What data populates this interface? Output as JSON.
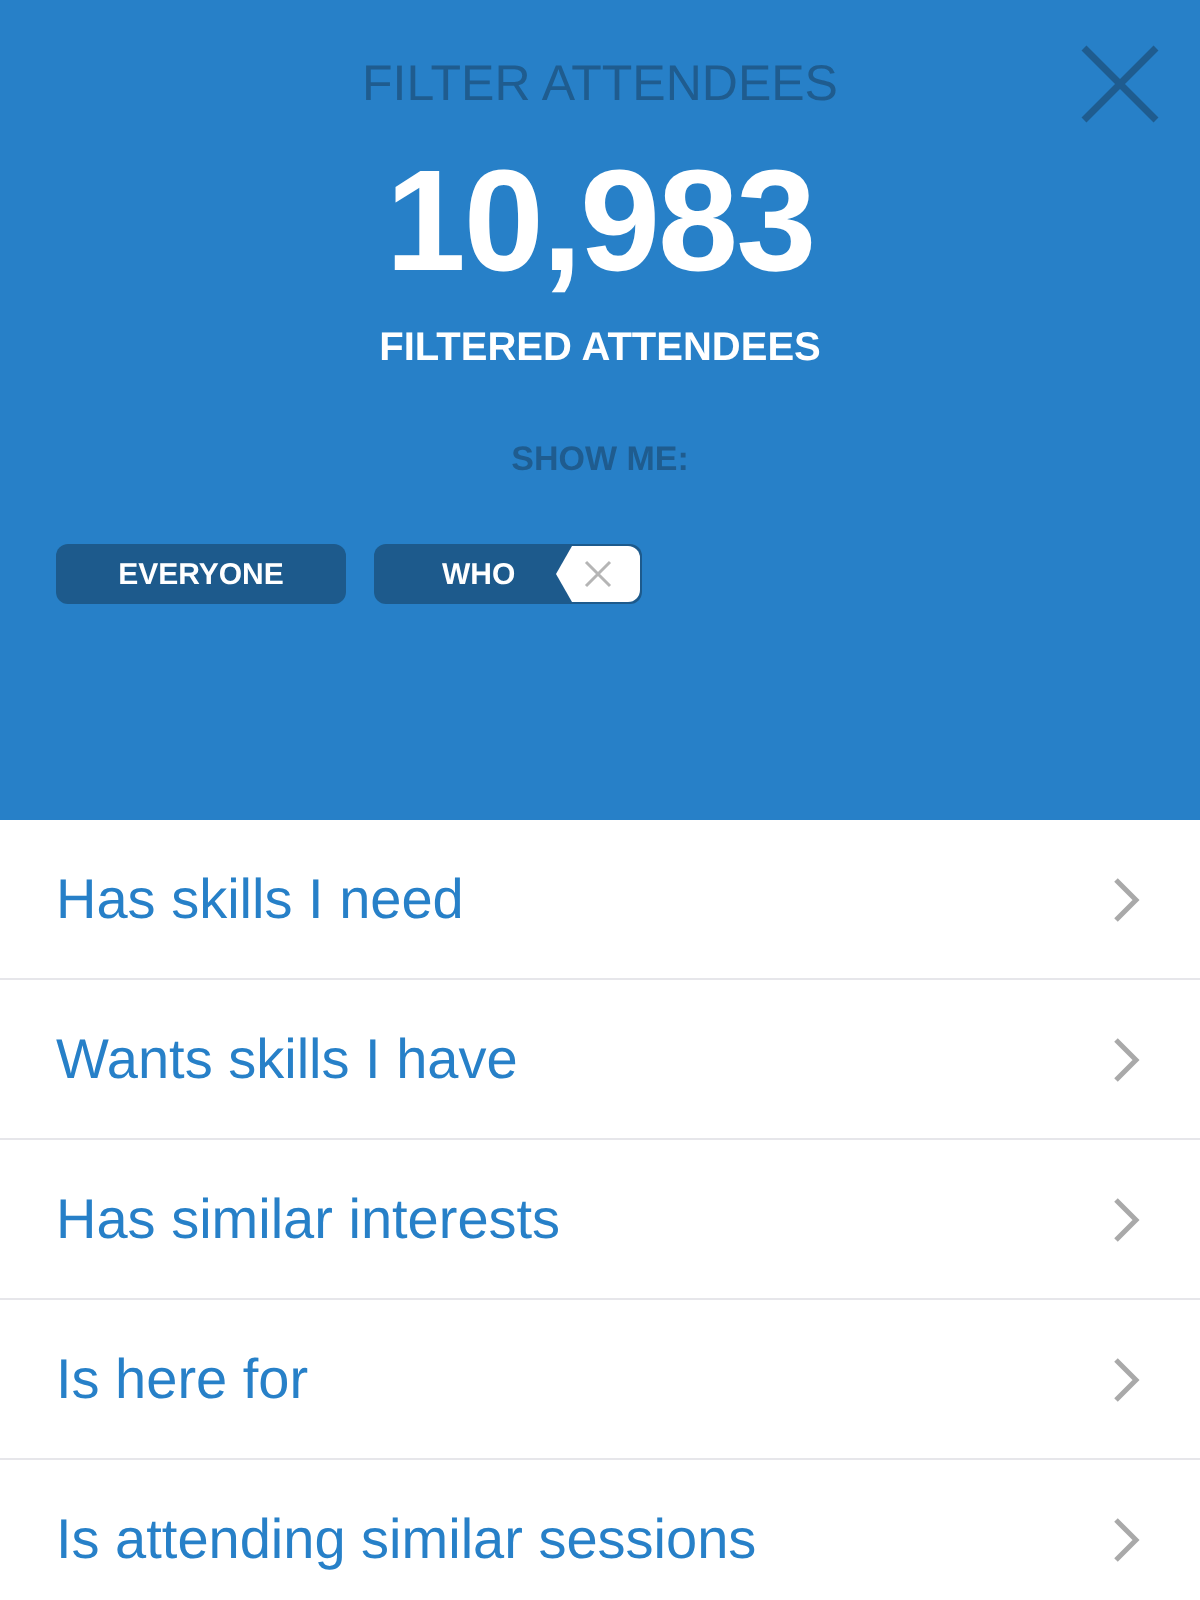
{
  "header": {
    "title": "FILTER ATTENDEES",
    "count": "10,983",
    "count_label": "FILTERED ATTENDEES",
    "show_me_label": "SHOW ME:"
  },
  "chips": [
    {
      "label": "EVERYONE",
      "removable": false
    },
    {
      "label": "WHO",
      "removable": true
    }
  ],
  "filters": [
    {
      "label": "Has skills I need"
    },
    {
      "label": "Wants skills I have"
    },
    {
      "label": "Has similar interests"
    },
    {
      "label": "Is here for"
    },
    {
      "label": "Is attending similar sessions"
    }
  ]
}
